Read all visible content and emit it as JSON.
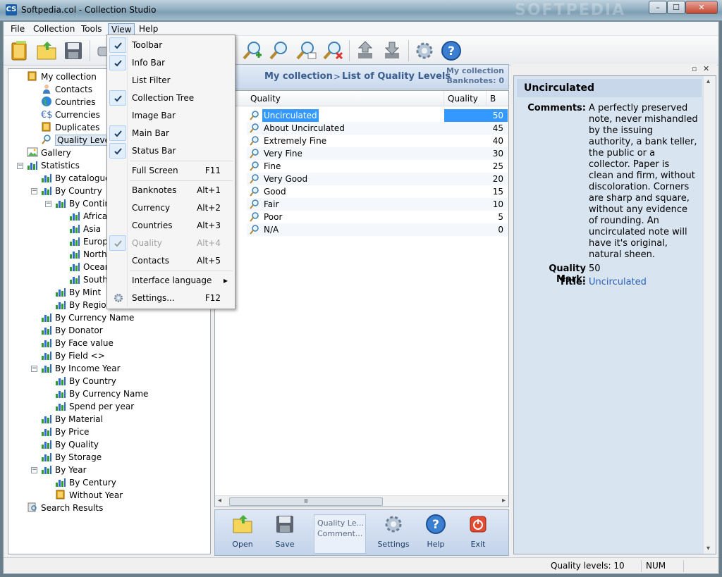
{
  "window": {
    "app_icon": "CS",
    "title": "Softpedia.col - Collection Studio",
    "minimize": "–",
    "maximize": "☐",
    "close": "✕",
    "watermark": "SOFTPEDIA"
  },
  "menubar": [
    "File",
    "Collection",
    "Tools",
    "View",
    "Help"
  ],
  "toolbar_icons": [
    "open-book-icon",
    "open-folder-icon",
    "save-icon",
    "print-icon",
    "add-search-icon",
    "search-icon",
    "search-comment-icon",
    "search-delete-icon",
    "import-icon",
    "export-icon",
    "settings-icon",
    "help-icon"
  ],
  "view_menu": {
    "items": [
      {
        "label": "Toolbar",
        "checked": true
      },
      {
        "label": "Info Bar",
        "checked": true
      },
      {
        "label": "List Filter",
        "checked": false
      },
      {
        "label": "Collection Tree",
        "checked": true
      },
      {
        "label": "Image Bar",
        "checked": false
      },
      {
        "label": "Main Bar",
        "checked": true
      },
      {
        "label": "Status Bar",
        "checked": true
      },
      {
        "label": "Full Screen",
        "shortcut": "F11"
      },
      {
        "label": "Banknotes",
        "shortcut": "Alt+1"
      },
      {
        "label": "Currency",
        "shortcut": "Alt+2"
      },
      {
        "label": "Countries",
        "shortcut": "Alt+3"
      },
      {
        "label": "Quality",
        "shortcut": "Alt+4",
        "checked": true,
        "disabled": true
      },
      {
        "label": "Contacts",
        "shortcut": "Alt+5"
      },
      {
        "label": "Interface language",
        "submenu_arrow": "▸"
      },
      {
        "label": "Settings...",
        "shortcut": "F12"
      }
    ]
  },
  "tree": [
    {
      "label": "My collection",
      "icon": "book-icon"
    },
    {
      "label": "Contacts",
      "icon": "person-icon"
    },
    {
      "label": "Countries",
      "icon": "globe-icon"
    },
    {
      "label": "Currencies",
      "icon": "currency-icon"
    },
    {
      "label": "Duplicates",
      "icon": "book-icon"
    },
    {
      "label": "Quality Levels",
      "icon": "magnifier-icon"
    },
    {
      "label": "Gallery",
      "icon": "picture-icon"
    },
    {
      "label": "Statistics",
      "icon": "chart-icon"
    },
    {
      "label": "By catalogue va",
      "icon": "chart-icon"
    },
    {
      "label": "By Country",
      "icon": "chart-icon"
    },
    {
      "label": "By Continer",
      "icon": "chart-icon"
    },
    {
      "label": "Africa",
      "icon": "chart-icon"
    },
    {
      "label": "Asia",
      "icon": "chart-icon"
    },
    {
      "label": "Europe",
      "icon": "chart-icon"
    },
    {
      "label": "North A",
      "icon": "chart-icon"
    },
    {
      "label": "Oceani",
      "icon": "chart-icon"
    },
    {
      "label": "South A",
      "icon": "chart-icon"
    },
    {
      "label": "By Mint",
      "icon": "chart-icon"
    },
    {
      "label": "By Region",
      "icon": "chart-icon"
    },
    {
      "label": "By Currency Name",
      "icon": "chart-icon"
    },
    {
      "label": "By Donator",
      "icon": "chart-icon"
    },
    {
      "label": "By Face value",
      "icon": "chart-icon"
    },
    {
      "label": "By Field <>",
      "icon": "chart-icon"
    },
    {
      "label": "By Income Year",
      "icon": "chart-icon"
    },
    {
      "label": "By Country",
      "icon": "chart-icon"
    },
    {
      "label": "By Currency Name",
      "icon": "chart-icon"
    },
    {
      "label": "Spend per year",
      "icon": "chart-icon"
    },
    {
      "label": "By Material",
      "icon": "chart-icon"
    },
    {
      "label": "By Price",
      "icon": "chart-icon"
    },
    {
      "label": "By Quality",
      "icon": "chart-icon"
    },
    {
      "label": "By Storage",
      "icon": "chart-icon"
    },
    {
      "label": "By Year",
      "icon": "chart-icon"
    },
    {
      "label": "By Century",
      "icon": "chart-icon"
    },
    {
      "label": "Without Year",
      "icon": "book-icon"
    },
    {
      "label": "Search Results",
      "icon": "search-results-icon"
    }
  ],
  "info_bar": {
    "breadcrumb_root": "My collection",
    "breadcrumb_sep": ">",
    "breadcrumb_current": "List of Quality Levels",
    "collection_name": "My collection",
    "banknotes_count": "Banknotes: 0"
  },
  "list": {
    "columns": [
      "Quality",
      "Quality ...",
      "B"
    ],
    "rows": [
      {
        "name": "Uncirculated",
        "value": "50"
      },
      {
        "name": "About Uncirculated",
        "value": "45"
      },
      {
        "name": "Extremely Fine",
        "value": "40"
      },
      {
        "name": "Very Fine",
        "value": "30"
      },
      {
        "name": "Fine",
        "value": "25"
      },
      {
        "name": "Very Good",
        "value": "20"
      },
      {
        "name": "Good",
        "value": "15"
      },
      {
        "name": "Fair",
        "value": "10"
      },
      {
        "name": "Poor",
        "value": "5"
      },
      {
        "name": "N/A",
        "value": "0"
      }
    ],
    "scroll_left": "◂",
    "scroll_thumb": "Ⅲ",
    "scroll_right": "▸"
  },
  "bottom_bar": {
    "open": "Open",
    "save": "Save",
    "note_line1": "Quality Le...",
    "note_line2": "Comment...",
    "settings": "Settings",
    "help": "Help",
    "exit": "Exit"
  },
  "detail": {
    "title": "Uncirculated",
    "comments_label": "Comments:",
    "comments_lines": [
      "A perfectly preserved",
      "note, never mishandled",
      "by the issuing",
      "authority, a bank teller,",
      "the public or a",
      "collector. Paper is",
      "clean and firm, without",
      "discoloration. Corners",
      "are sharp and square,",
      "without any evidence",
      "of rounding. An",
      "uncirculated note will",
      "have it's original,",
      "natural sheen."
    ],
    "quality_mark_label": "Quality Mark:",
    "quality_mark_value": "50",
    "title_label": "Title:",
    "title_value": "Uncirculated",
    "pin": "▫",
    "close": "✕",
    "scroll_up": "▴",
    "scroll_down": "▾"
  },
  "status": {
    "count": "Quality levels: 10",
    "num": "NUM"
  },
  "colors": {
    "selection": "#3399ff",
    "link": "#2a63b8",
    "info_text": "#3b5e8c"
  }
}
